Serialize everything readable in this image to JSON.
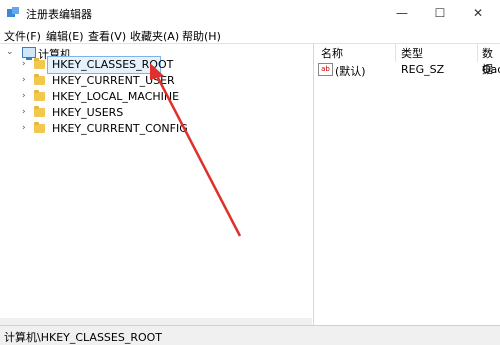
{
  "window": {
    "title": "注册表编辑器",
    "minimize": "—",
    "maximize": "☐",
    "close": "✕"
  },
  "menu": [
    "文件(F)",
    "编辑(E)",
    "查看(V)",
    "收藏夹(A)",
    "帮助(H)"
  ],
  "tree": {
    "root": "计算机",
    "items": [
      "HKEY_CLASSES_ROOT",
      "HKEY_CURRENT_USER",
      "HKEY_LOCAL_MACHINE",
      "HKEY_USERS",
      "HKEY_CURRENT_CONFIG"
    ],
    "selected": "HKEY_CLASSES_ROOT"
  },
  "list": {
    "columns": [
      "名称",
      "类型",
      "数据"
    ],
    "rows": [
      {
        "name": "(默认)",
        "type": "REG_SZ",
        "data": "Gac"
      }
    ]
  },
  "status": "计算机\\HKEY_CLASSES_ROOT",
  "icons": {
    "value_icon": "ab-icon",
    "arrow_color": "#e0302c",
    "folder_color": "#f2c94c"
  }
}
